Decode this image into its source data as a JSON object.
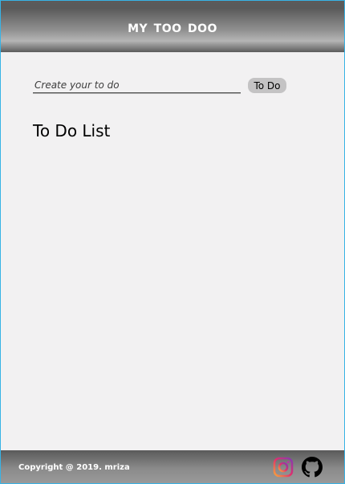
{
  "header": {
    "title": "my too doo"
  },
  "form": {
    "placeholder": "Create your to do",
    "value": "",
    "button_label": "To Do"
  },
  "list": {
    "heading": "To Do List",
    "items": []
  },
  "footer": {
    "copyright": "Copyright @ 2019. mriza",
    "social": [
      {
        "icon": "instagram-icon"
      },
      {
        "icon": "github-icon"
      }
    ]
  },
  "colors": {
    "frame_border": "#37b3e6",
    "page_bg": "#f2f1f2",
    "button_bg": "#c4c3c4"
  }
}
